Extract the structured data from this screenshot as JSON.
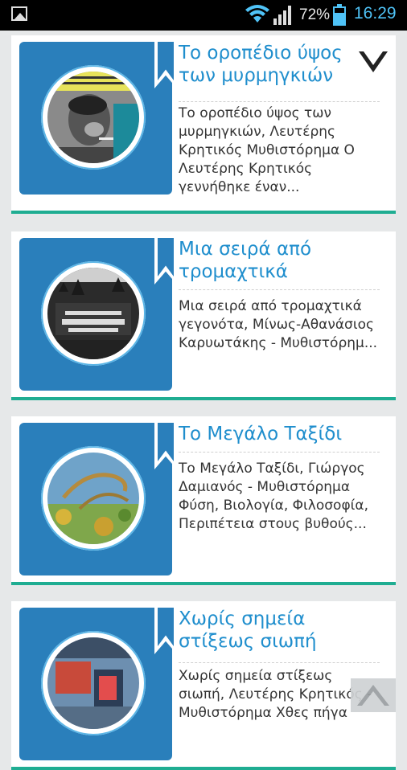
{
  "status_bar": {
    "battery_percent": "72%",
    "time": "16:29",
    "icons": [
      "gallery-icon",
      "wifi-icon",
      "signal-icon",
      "battery-icon"
    ]
  },
  "colors": {
    "accent": "#1f8ecd",
    "card_divider": "#1fad92",
    "cover_bg": "#2a7fbb",
    "time": "#4fc3f7"
  },
  "books": [
    {
      "title": "Το οροπέδιο ύψος των μυρμηγκιών",
      "description": "Το οροπέδιο ύψος των μυρμηγκιών, Λευτέρης Κρητικός Μυθιστόρημα Ο Λευτέρης Κρητικός γεννήθηκε έναν..."
    },
    {
      "title": "Μια σειρά από τρομαχτικά γεγονότα",
      "description": "Μια σειρά από τρομαχτικά γεγονότα, Μίνως-Αθανάσιος Καρυωτάκης - Μυθιστόρημ..."
    },
    {
      "title": "Το Μεγάλο Ταξίδι",
      "description": "Το Μεγάλο Ταξίδι, Γιώργος Δαμιανός - Μυθιστόρημα Φύση, Βιολογία, Φιλοσοφία, Περιπέτεια στους βυθούς..."
    },
    {
      "title": "Χωρίς σημεία στίξεως σιωπή",
      "description": "Χωρίς σημεία στίξεως σιωπή, Λευτέρης Κρητικός - Μυθιστόρημα Χθες πήγα"
    }
  ]
}
